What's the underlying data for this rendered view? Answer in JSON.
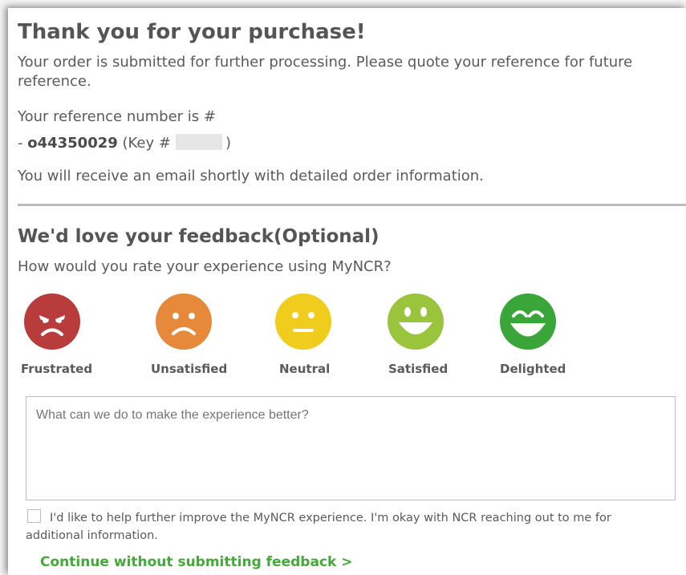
{
  "confirmation": {
    "title": "Thank you for your purchase!",
    "submitted_text": "Your order is submitted for further processing. Please quote your reference for future reference.",
    "reference_label": "Your reference number is #",
    "reference_prefix": "- ",
    "reference_number": "o44350029",
    "key_open": " (Key #",
    "key_close": ")",
    "email_note": "You will receive an email shortly with detailed order information."
  },
  "feedback": {
    "title": "We'd love your feedback(Optional)",
    "question": "How would you rate your experience using MyNCR?",
    "ratings": [
      {
        "label": "Frustrated",
        "icon": "frustrated-face-icon",
        "color": "#b83c3c"
      },
      {
        "label": "Unsatisfied",
        "icon": "unsatisfied-face-icon",
        "color": "#e6893a"
      },
      {
        "label": "Neutral",
        "icon": "neutral-face-icon",
        "color": "#f0cc1c"
      },
      {
        "label": "Satisfied",
        "icon": "satisfied-face-icon",
        "color": "#9ac43c"
      },
      {
        "label": "Delighted",
        "icon": "delighted-face-icon",
        "color": "#3aa63a"
      }
    ],
    "comment_placeholder": "What can we do to make the experience better?",
    "contact_consent": "I'd like to help further improve the MyNCR experience. I'm okay with NCR reaching out to me for additional information.",
    "continue_link": "Continue without submitting feedback >"
  },
  "colors": {
    "link_green": "#44a83a",
    "divider": "#bcbcbc"
  }
}
